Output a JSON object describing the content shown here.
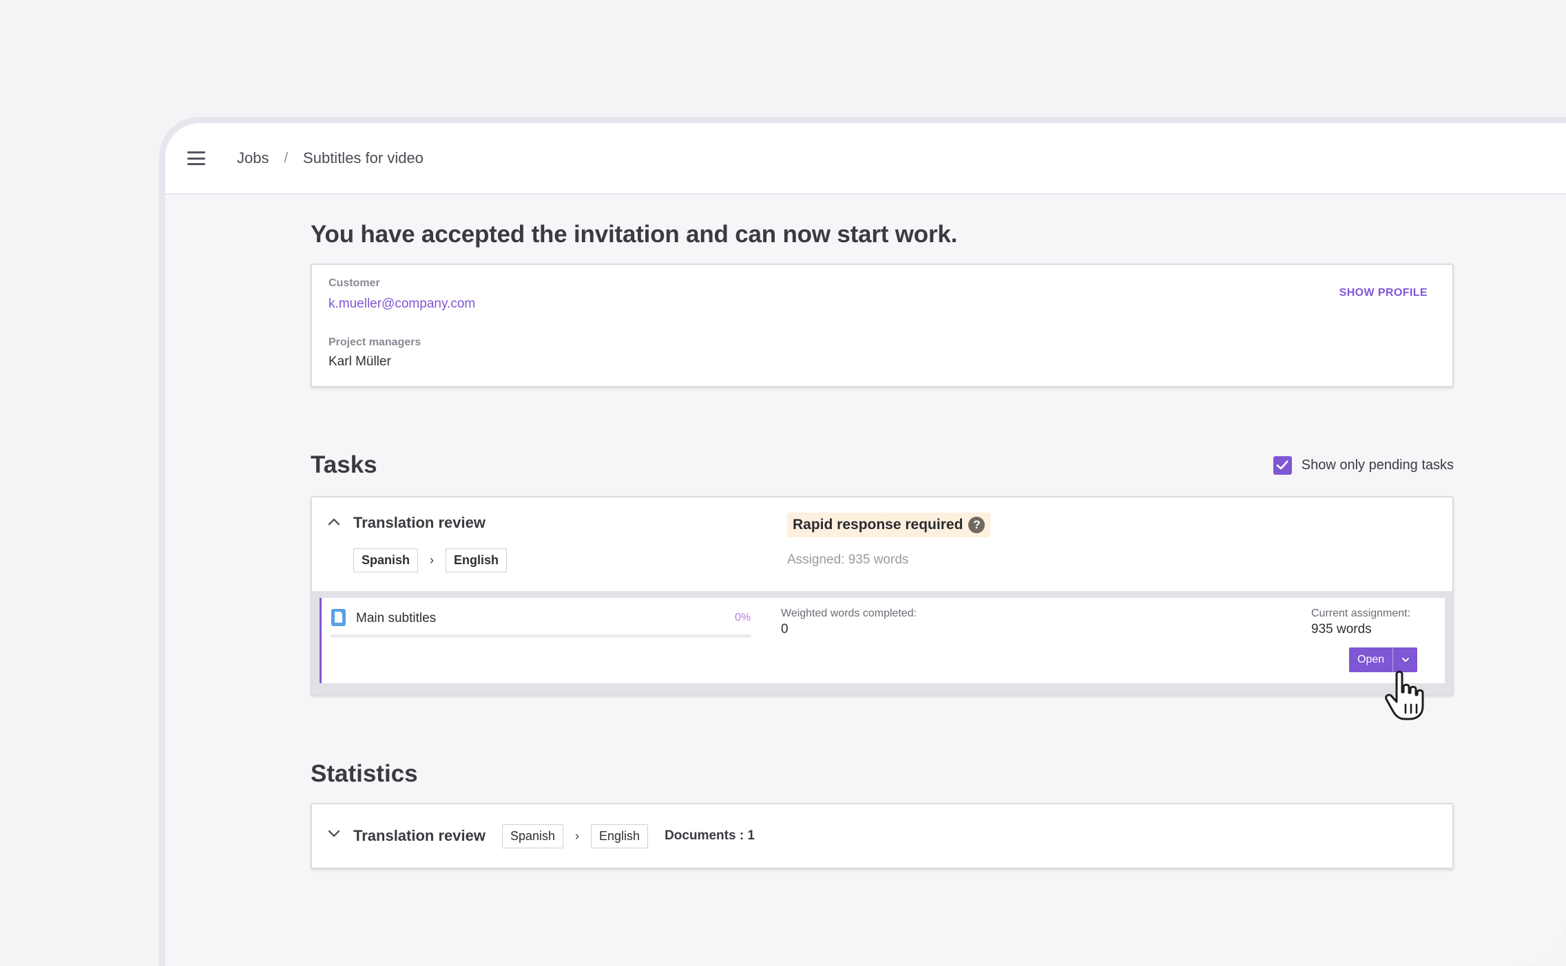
{
  "breadcrumb": {
    "jobs": "Jobs",
    "separator": "/",
    "current": "Subtitles for video"
  },
  "headline": "You have accepted the invitation and can now start work.",
  "customer": {
    "label": "Customer",
    "email": "k.mueller@company.com",
    "show_profile": "SHOW PROFILE",
    "pm_label": "Project managers",
    "pm_name": "Karl Müller"
  },
  "tasks": {
    "title": "Tasks",
    "pending_toggle": {
      "label": "Show only pending tasks",
      "checked": true
    },
    "task": {
      "title": "Translation review",
      "source_lang": "Spanish",
      "target_lang": "English",
      "arrow": "›",
      "rapid_badge": "Rapid response required",
      "help_glyph": "?",
      "assigned": "Assigned: 935 words",
      "document": {
        "name": "Main subtitles",
        "progress_label": "0%",
        "progress_value": 0,
        "weighted_label": "Weighted words completed:",
        "weighted_value": "0",
        "current_label": "Current assignment:",
        "current_value": "935 words",
        "open_button": "Open"
      }
    }
  },
  "statistics": {
    "title": "Statistics",
    "task": "Translation review",
    "source_lang": "Spanish",
    "target_lang": "English",
    "arrow": "›",
    "documents": "Documents : 1"
  },
  "colors": {
    "accent": "#7e57d4",
    "badge_bg": "#fdf0df",
    "progress_text": "#c07ae0",
    "doc_icon": "#5aa0e8"
  },
  "icons": [
    "menu-icon",
    "chevron-up-icon",
    "chevron-down-icon",
    "question-icon",
    "document-icon",
    "checkmark-icon",
    "caret-down-icon",
    "hand-pointer-icon"
  ]
}
